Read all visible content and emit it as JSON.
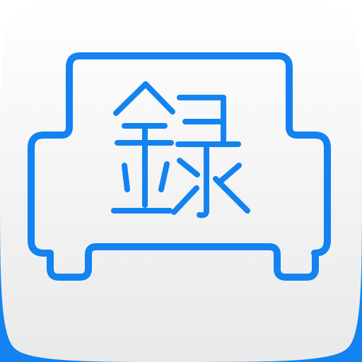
{
  "app_icon": {
    "logo_text": "録",
    "colors": {
      "accent": "#1283F0",
      "tile_top": "#FFFFFF",
      "tile_bottom": "#E9E9E9",
      "corner_fill": "#1283F0",
      "page_background": "#FFFFFF"
    },
    "icons": {
      "car": "car-outline-icon",
      "kanji": "kanji-roku-icon"
    }
  }
}
